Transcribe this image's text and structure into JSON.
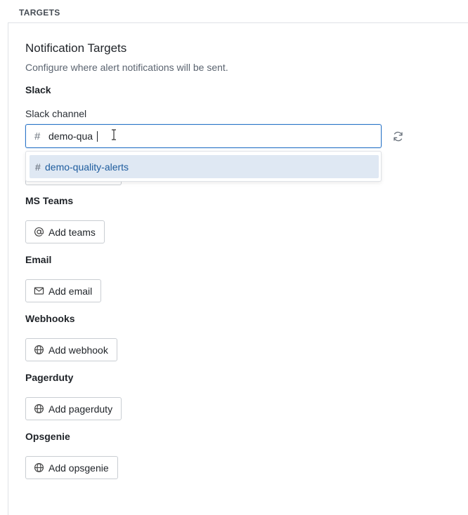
{
  "section_label": "TARGETS",
  "title": "Notification Targets",
  "subtitle": "Configure where alert notifications will be sent.",
  "slack": {
    "label": "Slack",
    "field_label": "Slack channel",
    "prefix": "#",
    "input_value": "demo-qua",
    "suggestions": [
      {
        "prefix": "#",
        "label": "demo-quality-alerts"
      }
    ]
  },
  "teams": {
    "label": "MS Teams",
    "button": "Add teams"
  },
  "email": {
    "label": "Email",
    "button": "Add email"
  },
  "webhooks": {
    "label": "Webhooks",
    "button": "Add webhook"
  },
  "pagerduty": {
    "label": "Pagerduty",
    "button": "Add pagerduty"
  },
  "opsgenie": {
    "label": "Opsgenie",
    "button": "Add opsgenie"
  },
  "icons": {
    "refresh": "refresh-icon",
    "teams": "at-sign-icon",
    "email": "envelope-icon",
    "webhook": "globe-icon",
    "pagerduty": "globe-icon",
    "opsgenie": "globe-icon"
  },
  "colors": {
    "accent": "#2e77c8",
    "selected_option_bg": "#dfe8f3",
    "selected_option_text": "#1d5c9e"
  }
}
